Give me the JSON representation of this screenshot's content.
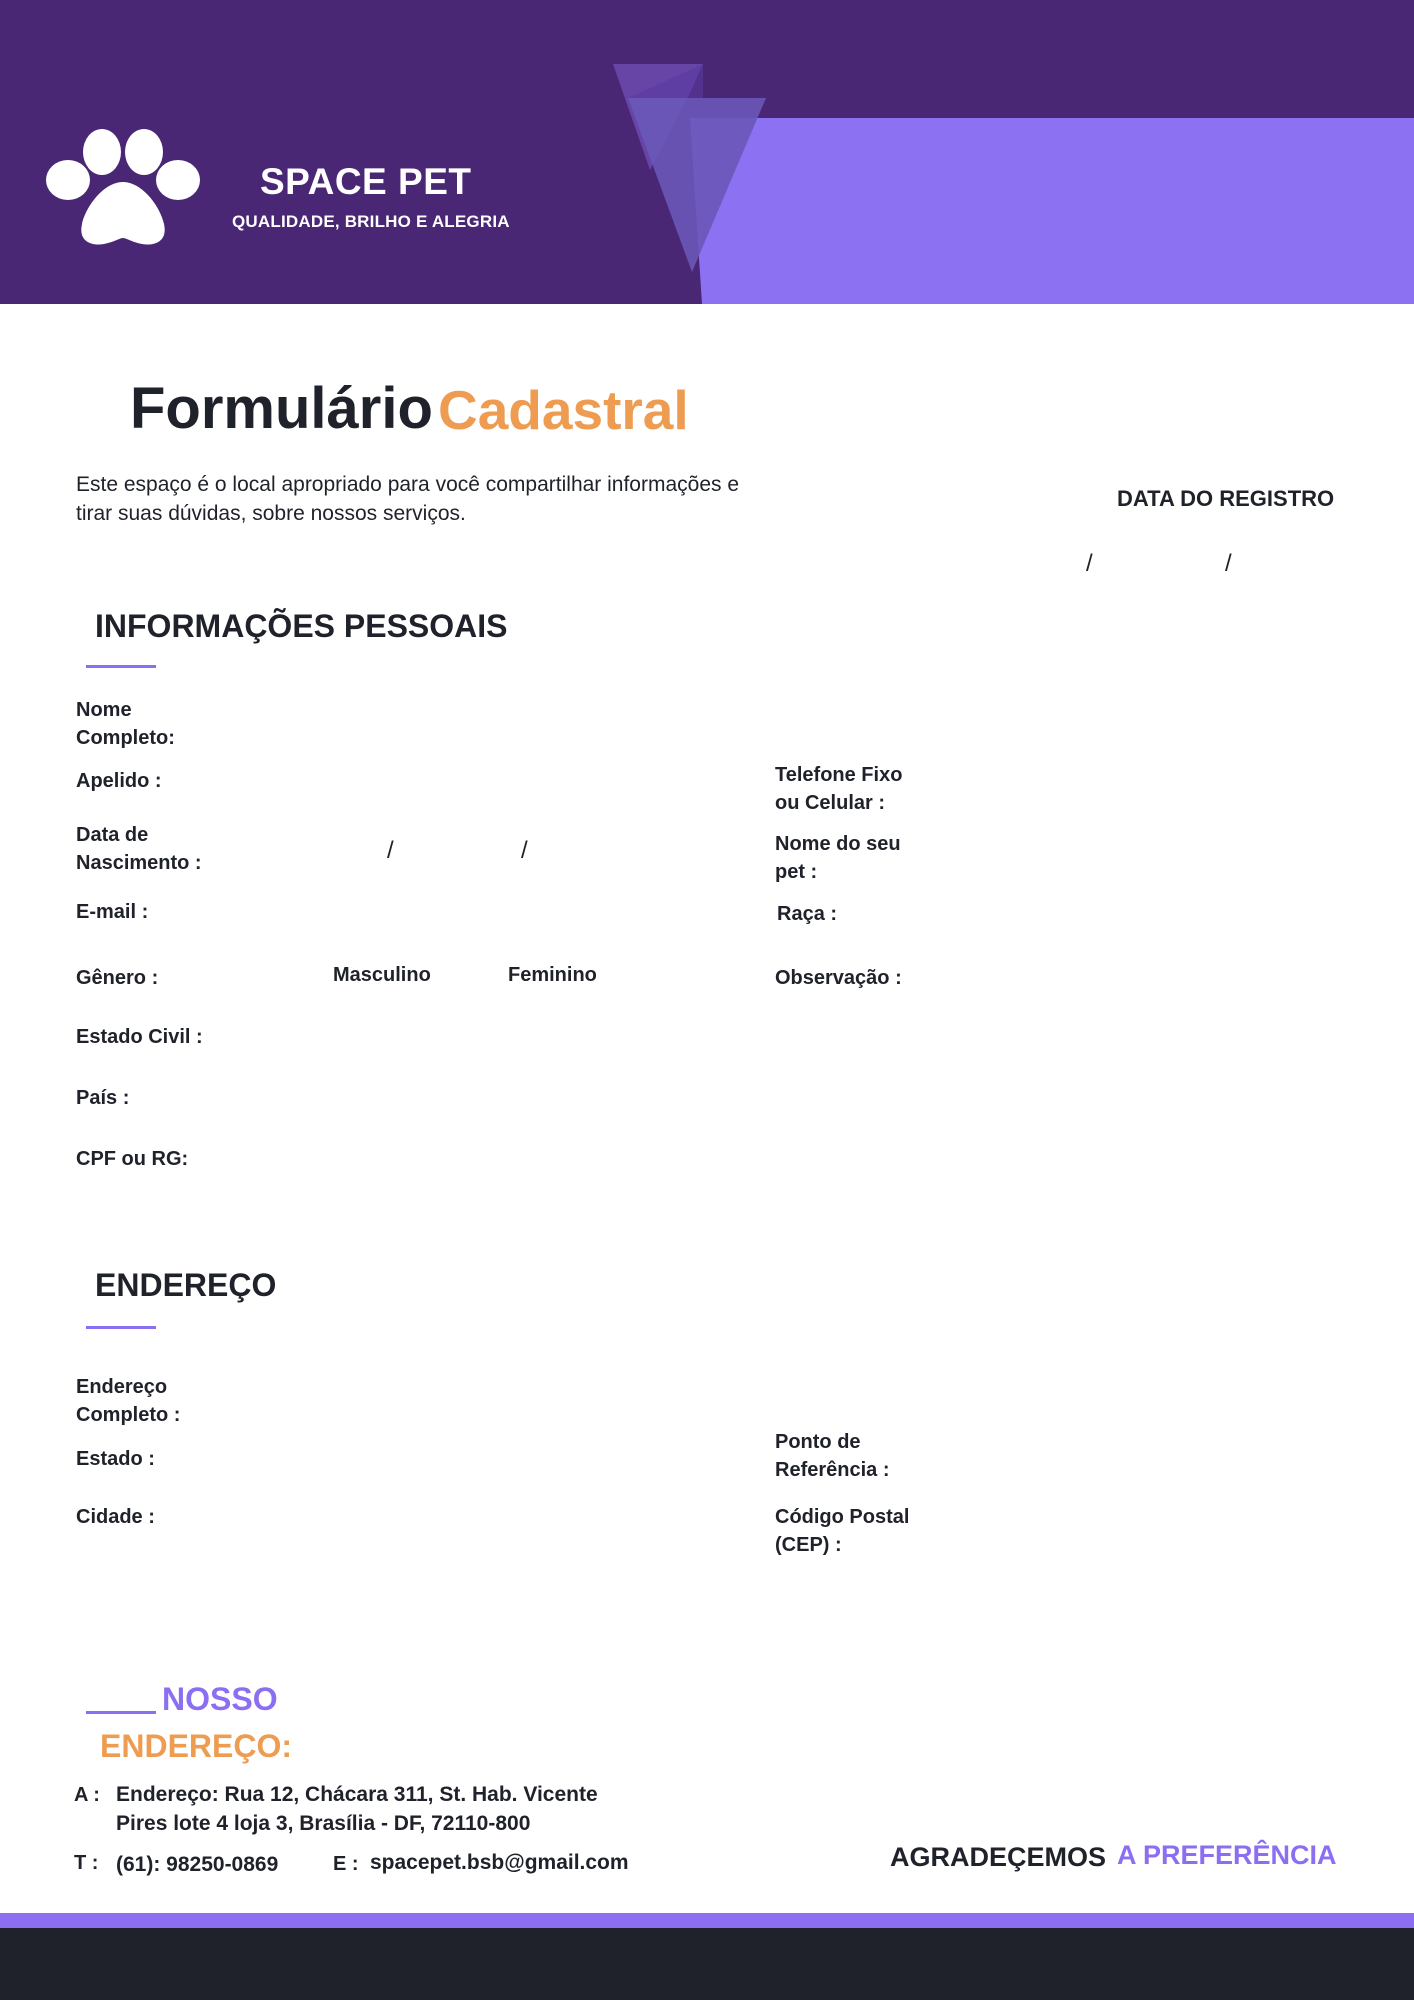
{
  "colors": {
    "header_dark": "#4a2774",
    "header_light": "#8c72f2",
    "accent_orange": "#ee9c51",
    "accent_purple": "#8c6ef2",
    "text_dark": "#1f222a"
  },
  "header": {
    "logo_icon": "paw-icon",
    "brand_name": "SPACE PET",
    "tagline": "QUALIDADE, BRILHO E ALEGRIA"
  },
  "title": {
    "main": "Formulário",
    "accent": "Cadastral"
  },
  "intro": {
    "line1": "Este espaço é o local apropriado para você compartilhar informações e",
    "line2": "tirar suas dúvidas, sobre nossos serviços."
  },
  "registration": {
    "label": "DATA DO REGISTRO",
    "separator": "/"
  },
  "personal": {
    "title": "INFORMAÇÕES PESSOAIS",
    "full_name": [
      "Nome",
      "Completo:"
    ],
    "nickname": "Apelido :",
    "birth": [
      "Data de",
      "Nascimento :"
    ],
    "date_separator": "/",
    "email": "E-mail :",
    "gender": "Gênero :",
    "gender_options": [
      "Masculino",
      "Feminino"
    ],
    "marital": "Estado Civil :",
    "country": "País :",
    "id_doc": "CPF ou RG:",
    "phone": [
      "Telefone Fixo",
      "ou Celular :"
    ],
    "pet_name": [
      "Nome do seu",
      "pet :"
    ],
    "breed": "Raça :",
    "notes": "Observação :"
  },
  "address": {
    "title": "ENDEREÇO",
    "full_address": [
      "Endereço",
      "Completo :"
    ],
    "state": "Estado :",
    "city": "Cidade :",
    "reference": [
      "Ponto de",
      "Referência :"
    ],
    "postal": [
      "Código Postal",
      "(CEP) :"
    ]
  },
  "footer": {
    "heading1": "NOSSO",
    "heading2": "ENDEREÇO:",
    "address_key": "A :",
    "address_line1": "Endereço: Rua 12, Chácara 311, St. Hab. Vicente",
    "address_line2": "Pires lote 4 loja 3, Brasília - DF, 72110-800",
    "phone_key": "T :",
    "phone_value": "(61): 98250-0869",
    "email_key": "E :",
    "email_value": "spacepet.bsb@gmail.com",
    "thanks1": "AGRADEÇEMOS",
    "thanks2": "A PREFERÊNCIA"
  }
}
